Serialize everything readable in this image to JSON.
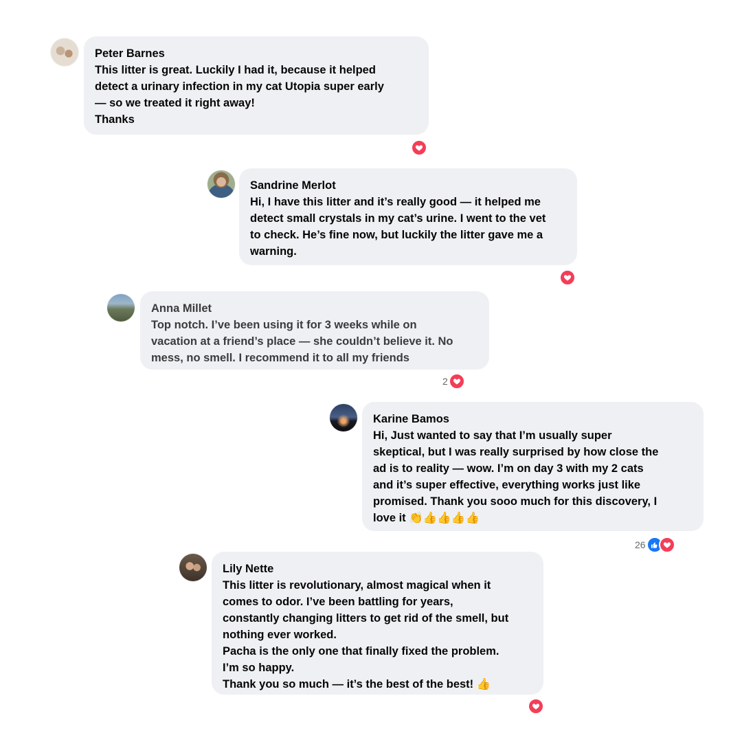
{
  "colors": {
    "bubble": "#eff0f3",
    "text": "#050505",
    "heart": "#f33e58",
    "like": "#1877f2",
    "count": "#65676b"
  },
  "comments": [
    {
      "author": "Peter Barnes",
      "text": "This litter is great. Luckily I had it, because it helped\ndetect a urinary infection in my cat Utopia super early\n— so we treated it right away!\n Thanks",
      "reactions": [
        "heart-icon"
      ],
      "reaction_count": ""
    },
    {
      "author": "Sandrine Merlot",
      "text": "Hi, I have this litter and it’s really good — it helped me\ndetect small crystals in my cat’s urine. I went to the vet\nto check. He’s fine now, but luckily the litter gave me a\nwarning.",
      "reactions": [
        "heart-icon"
      ],
      "reaction_count": ""
    },
    {
      "author": "Anna Millet",
      "text": "Top notch. I’ve been using it for 3 weeks while on\nvacation at a friend’s place — she couldn’t believe it. No\nmess, no smell. I recommend it to all my friends",
      "reactions": [
        "heart-icon"
      ],
      "reaction_count": "2"
    },
    {
      "author": "Karine Bamos",
      "text": "Hi, Just wanted to say that I’m usually super\nskeptical, but I was really surprised by how close the\nad is to reality — wow. I’m on day 3 with my 2 cats\nand it’s super effective, everything works just like\npromised. Thank you sooo much for this discovery, I\nlove it 👏👍👍👍👍",
      "reactions": [
        "like-icon",
        "heart-icon"
      ],
      "reaction_count": "26"
    },
    {
      "author": "Lily Nette",
      "text": "This litter is revolutionary, almost magical when it\ncomes to odor. I’ve been battling for years,\nconstantly changing litters to get rid of the smell, but\nnothing ever worked.\n Pacha is the only one that finally fixed the problem.\nI’m so happy.\n Thank you so much — it’s the best of the best! 👍",
      "reactions": [
        "heart-icon"
      ],
      "reaction_count": ""
    }
  ]
}
